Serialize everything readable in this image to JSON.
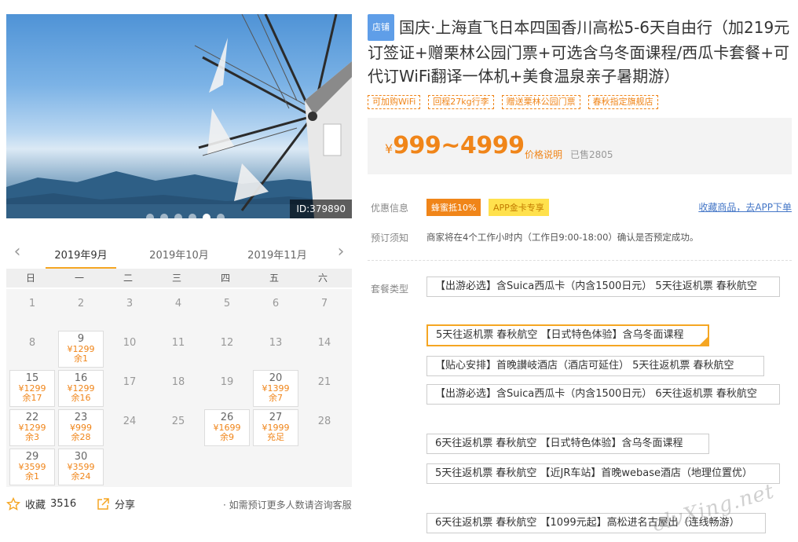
{
  "hero": {
    "image_id": "ID:379890",
    "slides": 6,
    "active_slide": 5
  },
  "calendar": {
    "prev_icon": "chevron-left-icon",
    "next_icon": "chevron-right-icon",
    "months": [
      "2019年9月",
      "2019年10月",
      "2019年11月"
    ],
    "active_month": 0,
    "weekdays": [
      "日",
      "一",
      "二",
      "三",
      "四",
      "五",
      "六"
    ],
    "days": [
      {
        "d": "1"
      },
      {
        "d": "2"
      },
      {
        "d": "3"
      },
      {
        "d": "4"
      },
      {
        "d": "5"
      },
      {
        "d": "6"
      },
      {
        "d": "7"
      },
      {
        "d": "8"
      },
      {
        "d": "9",
        "price": "¥1299",
        "remain": "余1"
      },
      {
        "d": "10"
      },
      {
        "d": "11"
      },
      {
        "d": "12"
      },
      {
        "d": "13"
      },
      {
        "d": "14"
      },
      {
        "d": "15",
        "price": "¥1299",
        "remain": "余17"
      },
      {
        "d": "16",
        "price": "¥1299",
        "remain": "余16"
      },
      {
        "d": "17"
      },
      {
        "d": "18"
      },
      {
        "d": "19"
      },
      {
        "d": "20",
        "price": "¥1399",
        "remain": "余7"
      },
      {
        "d": "21"
      },
      {
        "d": "22",
        "price": "¥1299",
        "remain": "余3"
      },
      {
        "d": "23",
        "price": "¥999",
        "remain": "余28"
      },
      {
        "d": "24"
      },
      {
        "d": "25"
      },
      {
        "d": "26",
        "price": "¥1699",
        "remain": "余9"
      },
      {
        "d": "27",
        "price": "¥1999",
        "remain": "充足"
      },
      {
        "d": "28"
      },
      {
        "d": "29",
        "price": "¥3599",
        "remain": "余1"
      },
      {
        "d": "30",
        "price": "¥3599",
        "remain": "余24"
      }
    ]
  },
  "actions": {
    "favorite_label": "收藏",
    "favorite_count": "3516",
    "share_label": "分享",
    "consult_text": "· 如需预订更多人数请咨询客服"
  },
  "product": {
    "shop_tag": "店铺",
    "title": "国庆·上海直飞日本四国香川高松5-6天自由行（加219元订签证+赠栗林公园门票+可选含乌冬面课程/西瓜卡套餐+可代订WiFi翻译一体机+美食温泉亲子暑期游）",
    "feature_tags": [
      "可加购WiFi",
      "回程27kg行李",
      "赠送栗林公园门票",
      "春秋指定旗舰店"
    ],
    "price_currency": "¥",
    "price_range": "999~4999",
    "price_note": "价格说明",
    "sold": "已售2805"
  },
  "offers": {
    "label": "优惠信息",
    "badges": [
      "蜂蜜抵10%",
      "APP金卡专享"
    ],
    "fav_app_link": "收藏商品，去APP下单"
  },
  "booking": {
    "label": "预订须知",
    "notice": "商家将在4个工作小时内（工作日9:00-18:00）确认是否预定成功。"
  },
  "packages": {
    "label": "套餐类型",
    "selected": 1,
    "items": [
      "【出游必选】含Suica西瓜卡（内含1500日元） 5天往返机票 春秋航空",
      "5天往返机票 春秋航空 【日式特色体验】含乌冬面课程",
      "【贴心安排】首晚讃岐酒店（酒店可延住） 5天往返机票 春秋航空",
      "【出游必选】含Suica西瓜卡（内含1500日元） 6天往返机票 春秋航空",
      "6天往返机票 春秋航空 【日式特色体验】含乌冬面课程",
      "5天往返机票 春秋航空 【近JR车站】首晚webase酒店（地理位置优）",
      "6天往返机票 春秋航空 【1099元起】高松进名古屋出（连线畅游）"
    ]
  },
  "watermark": "elvXing.net",
  "colors": {
    "accent": "#f08519",
    "calendar_underline": "#f5a623",
    "shop_tag": "#5f9ee8",
    "link": "#4577c7",
    "gold_badge": "#ffe14d"
  }
}
